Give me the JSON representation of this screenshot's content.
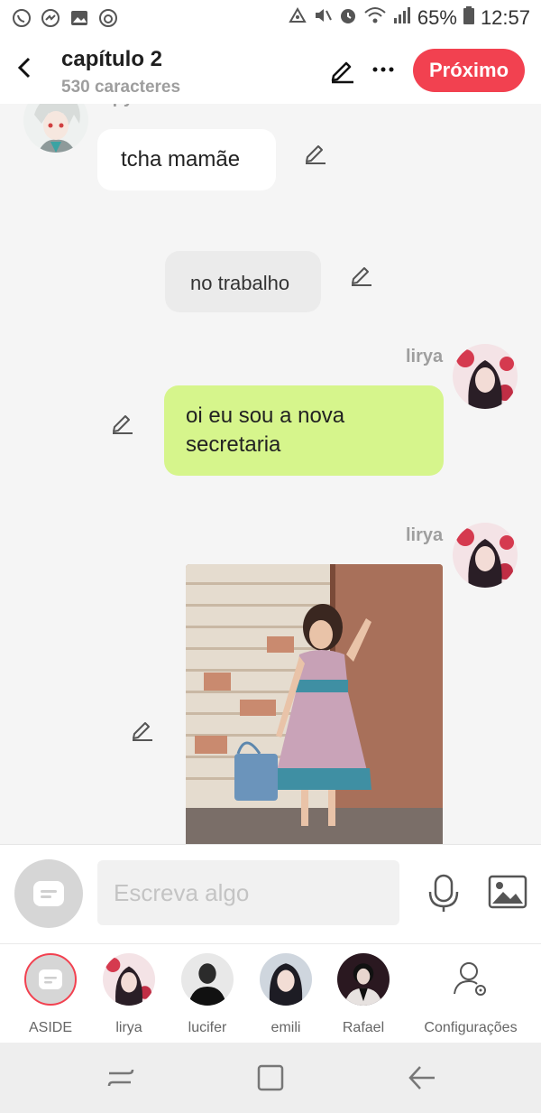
{
  "status_bar": {
    "battery": "65%",
    "time": "12:57",
    "left_icons": [
      "whatsapp-icon",
      "messenger-icon",
      "gallery-icon",
      "instagram-icon"
    ],
    "right_icons": [
      "hotspot-icon",
      "mute-icon",
      "alarm-icon",
      "wifi-icon",
      "signal-icon",
      "battery-icon"
    ]
  },
  "header": {
    "title": "capítulo 2",
    "subtitle": "530 caracteres",
    "next_label": "Próximo"
  },
  "messages": [
    {
      "sender": "lapy",
      "text": "tcha mamãe",
      "side": "left",
      "style": "white"
    },
    {
      "text": "no trabalho",
      "side": "center",
      "style": "narration"
    },
    {
      "sender": "lirya",
      "text": "oi eu sou a nova secretaria",
      "side": "right",
      "style": "green"
    },
    {
      "sender": "lirya",
      "type": "image",
      "side": "right"
    }
  ],
  "composer": {
    "placeholder": "Escreva algo"
  },
  "characters": [
    {
      "label": "ASIDE"
    },
    {
      "label": "lirya"
    },
    {
      "label": "lucifer"
    },
    {
      "label": "emili"
    },
    {
      "label": "Rafael"
    },
    {
      "label": "Configurações"
    }
  ],
  "colors": {
    "accent": "#f24150",
    "green_bubble": "#d6f58c",
    "narration_bubble": "#ebebeb",
    "background": "#f5f5f5"
  }
}
